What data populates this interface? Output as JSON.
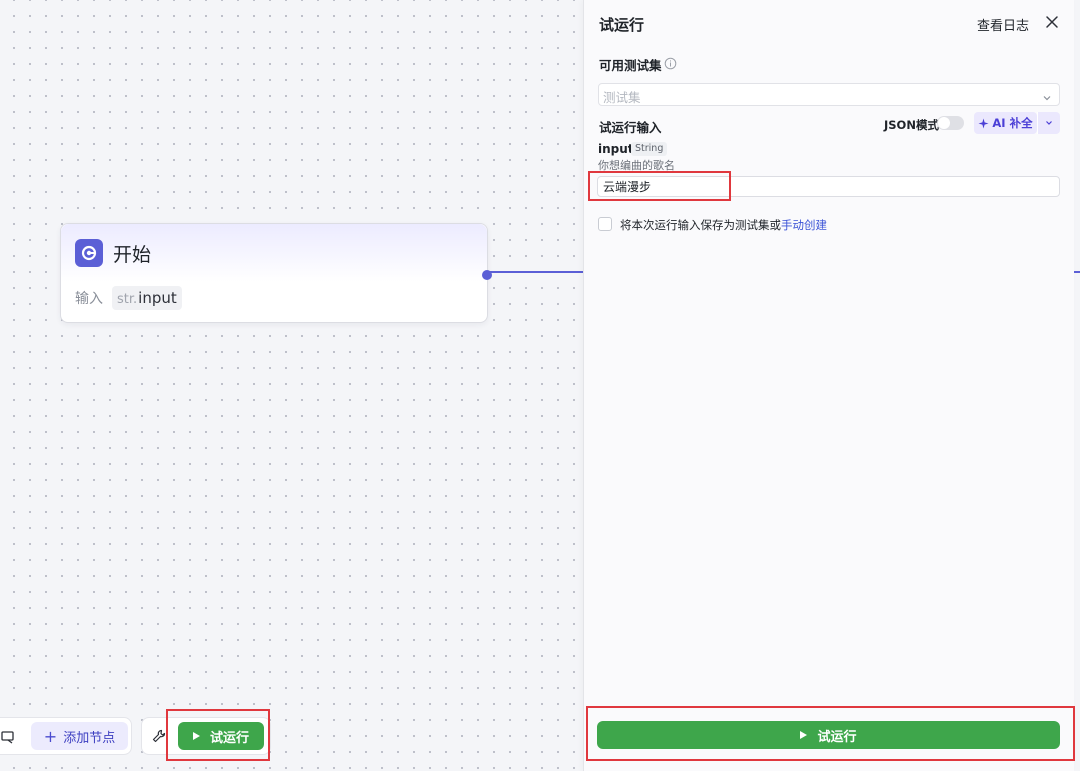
{
  "canvas": {
    "start_node": {
      "title": "开始",
      "input_label": "输入",
      "param_type": "str.",
      "param_name": "input"
    }
  },
  "toolbar": {
    "add_node_label": "添加节点",
    "run_label": "试运行"
  },
  "panel": {
    "title": "试运行",
    "view_log_label": "查看日志",
    "testset_section_label": "可用测试集",
    "testset_placeholder": "测试集",
    "run_input_section_label": "试运行输入",
    "json_mode_label": "JSON模式",
    "json_mode_enabled": false,
    "ai_fill_label": "AI 补全",
    "field": {
      "name": "input",
      "type": "String",
      "description": "你想编曲的歌名",
      "value": "云端漫步"
    },
    "save_checkbox_checked": false,
    "save_text": "将本次运行输入保存为测试集或",
    "save_link": "手动创建",
    "run_button_label": "试运行"
  },
  "colors": {
    "accent_purple": "#5b5fd6",
    "run_green": "#3ea64b",
    "highlight_red": "#e0383e",
    "link_blue": "#3b53d6"
  },
  "icons": [
    "start-node-icon",
    "cut-icon",
    "plus-icon",
    "wrench-icon",
    "play-icon",
    "info-icon",
    "chevron-down-icon",
    "close-icon",
    "sparkle-icon"
  ]
}
